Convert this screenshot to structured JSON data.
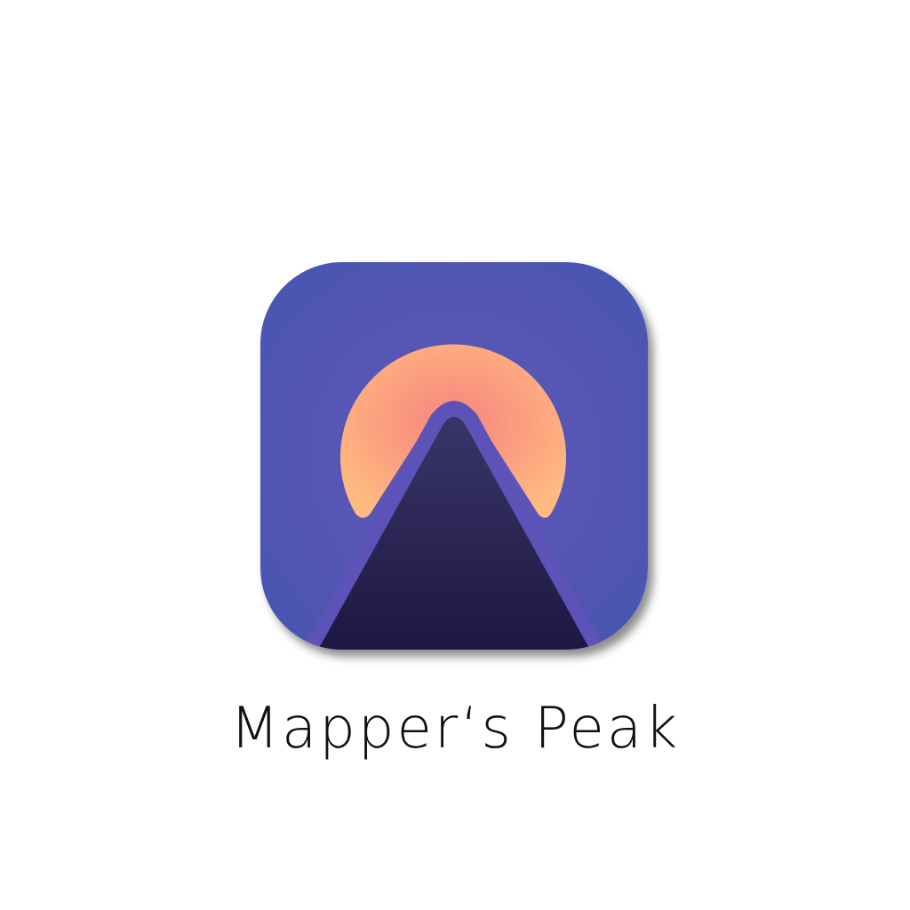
{
  "app": {
    "name": "Mapper‘s Peak",
    "icon": "mountain-sun-icon"
  },
  "colors": {
    "background": "#ffffff",
    "icon_bg_center": "#5a56b6",
    "icon_bg_edge": "#4356b0",
    "sun_center": "#f4857f",
    "sun_edge": "#ffb57f",
    "mountain_top": "#383566",
    "mountain_bottom": "#1c1440",
    "outline": "#5c52b8",
    "text": "#111111"
  }
}
